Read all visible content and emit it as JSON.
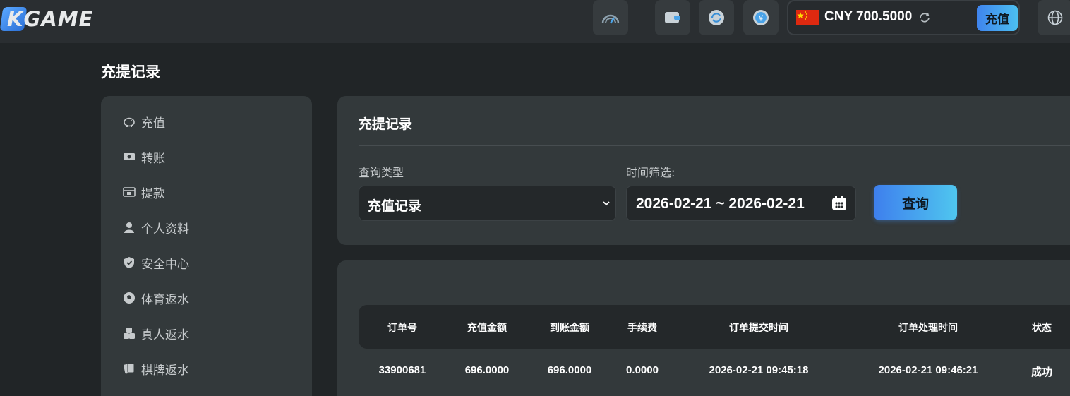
{
  "brand": {
    "logo_text": "KGAME"
  },
  "topbar": {
    "currency_code": "CNY",
    "balance": "700.5000",
    "currency_display": "CNY 700.5000",
    "deposit_label": "充值",
    "icons": [
      "speed-gauge-icon",
      "wallet-icon",
      "refresh-icon",
      "yuan-coin-icon",
      "globe-icon"
    ]
  },
  "page": {
    "title": "充提记录"
  },
  "sidebar": {
    "items": [
      {
        "label": "充值",
        "icon": "piggy-bank-icon"
      },
      {
        "label": "转账",
        "icon": "money-transfer-icon"
      },
      {
        "label": "提款",
        "icon": "withdraw-icon"
      },
      {
        "label": "个人资料",
        "icon": "user-icon"
      },
      {
        "label": "安全中心",
        "icon": "shield-icon"
      },
      {
        "label": "体育返水",
        "icon": "soccer-ball-icon"
      },
      {
        "label": "真人返水",
        "icon": "dice-icon"
      },
      {
        "label": "棋牌返水",
        "icon": "cards-icon"
      }
    ]
  },
  "filter": {
    "title": "充提记录",
    "type_label": "查询类型",
    "type_value": "充值记录",
    "time_label": "时间筛选:",
    "date_range": "2026-02-21 ~ 2026-02-21",
    "query_label": "查询"
  },
  "table": {
    "columns": [
      "订单号",
      "充值金额",
      "到账金额",
      "手续费",
      "订单提交时间",
      "订单处理时间",
      "状态"
    ],
    "rows": [
      [
        "33900681",
        "696.0000",
        "696.0000",
        "0.0000",
        "2026-02-21 09:45:18",
        "2026-02-21 09:46:21",
        "成功"
      ]
    ]
  },
  "colors": {
    "background": "#212527",
    "panel": "#33393b",
    "accent_start": "#3e7fed",
    "accent_end": "#4fc6ef"
  }
}
